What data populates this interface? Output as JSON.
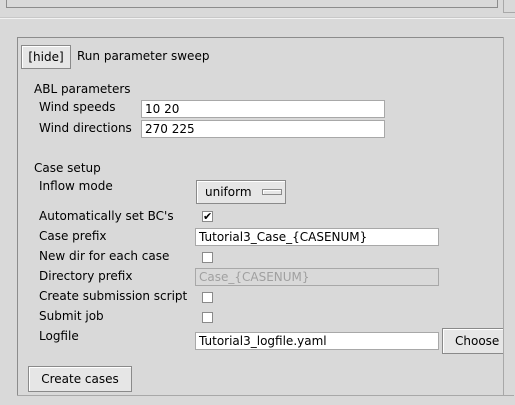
{
  "sweep": {
    "toggle_label": "[hide]",
    "title": "Run parameter sweep"
  },
  "abl": {
    "heading": "ABL parameters",
    "wind_speeds_label": "Wind speeds",
    "wind_speeds_value": "10 20",
    "wind_directions_label": "Wind directions",
    "wind_directions_value": "270 225"
  },
  "case_setup": {
    "heading": "Case setup",
    "inflow_mode_label": "Inflow mode",
    "inflow_mode_value": "uniform",
    "auto_bc_label": "Automatically set BC's",
    "auto_bc_checked": true,
    "case_prefix_label": "Case prefix",
    "case_prefix_value": "Tutorial3_Case_{CASENUM}",
    "new_dir_label": "New dir for each case",
    "new_dir_checked": false,
    "dir_prefix_label": "Directory prefix",
    "dir_prefix_value": "Case_{CASENUM}",
    "submission_script_label": "Create submission script",
    "submission_script_checked": false,
    "submit_job_label": "Submit job",
    "submit_job_checked": false,
    "logfile_label": "Logfile",
    "logfile_value": "Tutorial3_logfile.yaml",
    "choose_file_label": "Choose f"
  },
  "actions": {
    "create_cases_label": "Create cases"
  },
  "icons": {
    "check_mark": "✔"
  }
}
